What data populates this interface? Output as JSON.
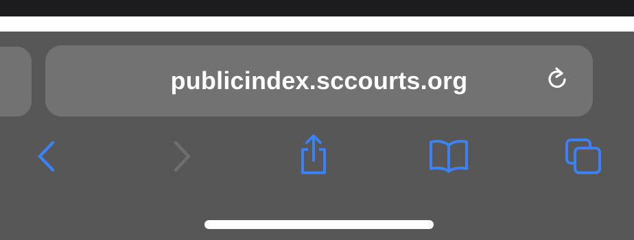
{
  "address_bar": {
    "url": "publicindex.sccourts.org",
    "reload_icon": "reload-icon"
  },
  "toolbar": {
    "back_icon": "chevron-left-icon",
    "forward_icon": "chevron-right-icon",
    "share_icon": "share-icon",
    "bookmarks_icon": "book-icon",
    "tabs_icon": "tabs-icon"
  },
  "colors": {
    "toolbar_bg": "#575757",
    "field_bg": "#727272",
    "accent": "#3b82f6",
    "disabled": "#6f6f6f",
    "text": "#ffffff"
  }
}
